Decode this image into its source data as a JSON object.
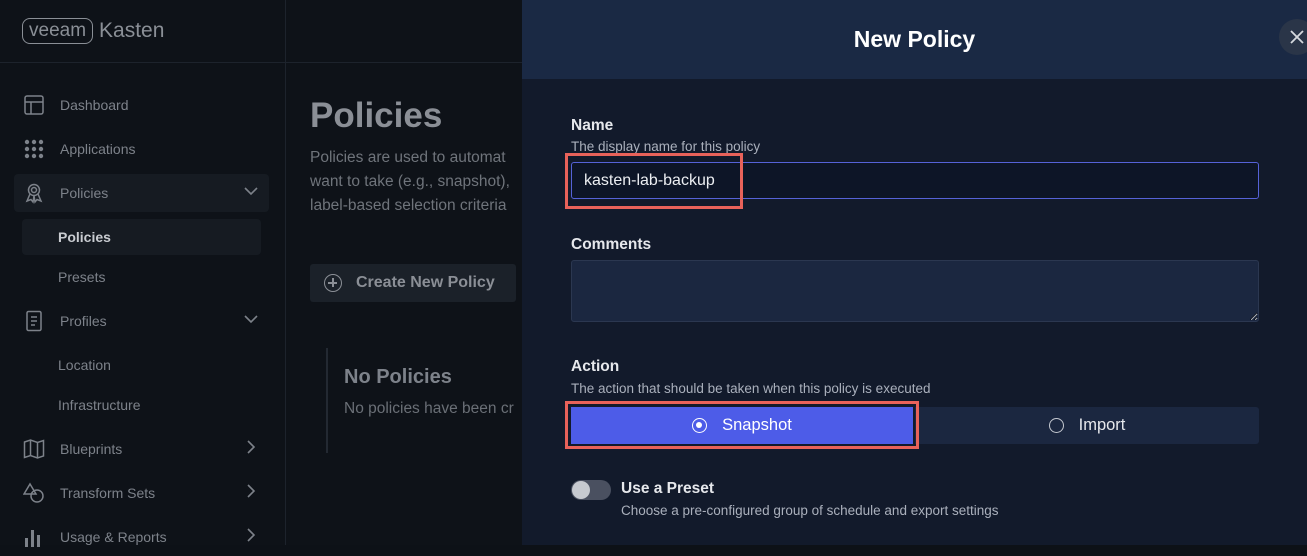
{
  "brand": {
    "logo_box": "veeam",
    "logo_text": "Kasten"
  },
  "sidebar": {
    "items": [
      {
        "label": "Dashboard",
        "icon": "dashboard-icon"
      },
      {
        "label": "Applications",
        "icon": "grid-icon"
      },
      {
        "label": "Policies",
        "icon": "policy-icon"
      },
      {
        "label": "Profiles",
        "icon": "profile-icon"
      },
      {
        "label": "Blueprints",
        "icon": "map-icon"
      },
      {
        "label": "Transform Sets",
        "icon": "shapes-icon"
      },
      {
        "label": "Usage & Reports",
        "icon": "bar-chart-icon"
      }
    ],
    "policies_sub": [
      "Policies",
      "Presets"
    ],
    "profiles_sub": [
      "Location",
      "Infrastructure"
    ]
  },
  "main": {
    "title": "Policies",
    "description": "Policies are used to automat\nwant to take (e.g., snapshot),\nlabel-based selection criteria",
    "create_button": "Create New Policy",
    "empty_title": "No Policies",
    "empty_desc": "No policies have been cr"
  },
  "modal": {
    "title": "New Policy",
    "name_label": "Name",
    "name_help": "The display name for this policy",
    "name_value": "kasten-lab-backup",
    "comments_label": "Comments",
    "comments_value": "",
    "action_label": "Action",
    "action_help": "The action that should be taken when this policy is executed",
    "action_options": [
      "Snapshot",
      "Import"
    ],
    "action_selected": "Snapshot",
    "preset_title": "Use a Preset",
    "preset_desc": "Choose a pre-configured group of schedule and export settings",
    "preset_enabled": false
  },
  "colors": {
    "accent": "#4d5ce8",
    "highlight": "#e8625a",
    "modal_header": "#1a2944"
  }
}
